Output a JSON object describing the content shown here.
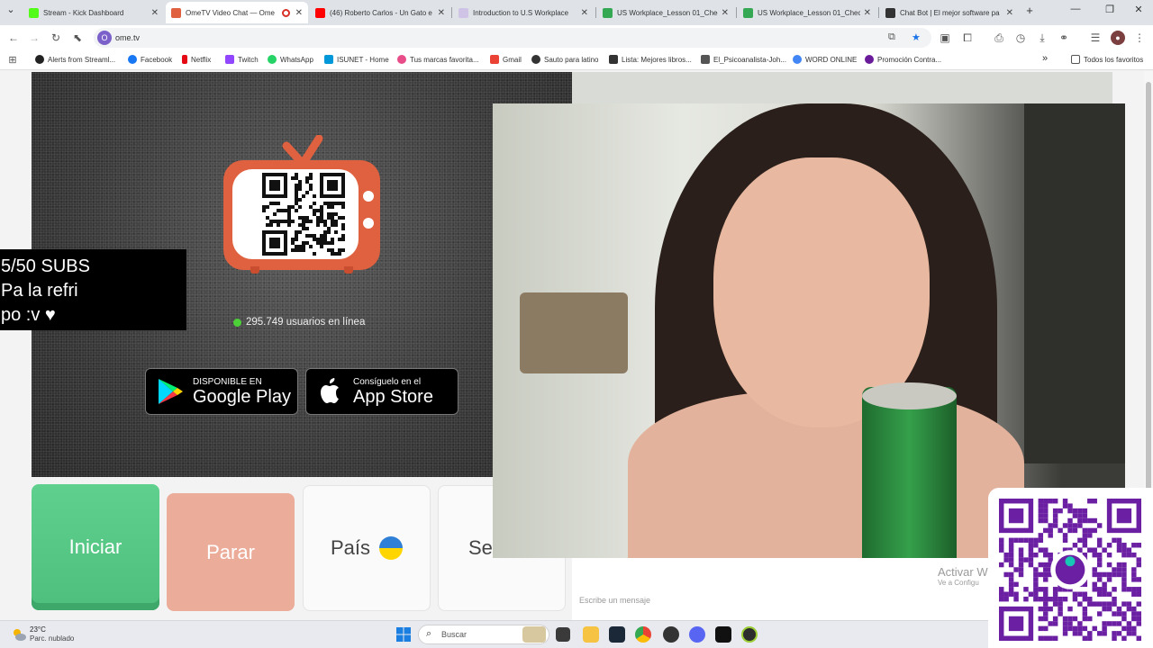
{
  "browser": {
    "tabs": [
      {
        "title": "Stream - Kick Dashboard",
        "favicon_color": "#53fc18",
        "active": false
      },
      {
        "title": "OmeTV Video Chat — Ome",
        "favicon_color": "#e0613f",
        "active": true
      },
      {
        "title": "(46) Roberto Carlos - Un Gato e",
        "favicon_color": "#ff0000",
        "active": false
      },
      {
        "title": "Introduction to U.S Workplace",
        "favicon_color": "#cfc4e6",
        "active": false
      },
      {
        "title": "US Workplace_Lesson 01_Chec",
        "favicon_color": "#34a853",
        "active": false
      },
      {
        "title": "US Workplace_Lesson 01_Chec",
        "favicon_color": "#34a853",
        "active": false
      },
      {
        "title": "Chat Bot | El mejor software pa",
        "favicon_color": "#333333",
        "active": false
      }
    ],
    "new_tab_label": "+",
    "url": "ome.tv",
    "site_icon_letter": "O",
    "bookmarks": [
      {
        "label": "Alerts from Streaml...",
        "icon_color": "#31c3a2"
      },
      {
        "label": "Facebook",
        "icon_color": "#1877f2"
      },
      {
        "label": "Netflix",
        "icon_color": "#e50914"
      },
      {
        "label": "Twitch",
        "icon_color": "#9146ff"
      },
      {
        "label": "WhatsApp",
        "icon_color": "#25d366"
      },
      {
        "label": "ISUNET - Home",
        "icon_color": "#0098d8"
      },
      {
        "label": "Tus marcas favorita...",
        "icon_color": "#e84d8a"
      },
      {
        "label": "Gmail",
        "icon_color": "#ea4335"
      },
      {
        "label": "Sauto para latino",
        "icon_color": "#333333"
      },
      {
        "label": "Lista: Mejores libros...",
        "icon_color": "#333333"
      },
      {
        "label": "El_Psicoanalista-Joh...",
        "icon_color": "#555555"
      },
      {
        "label": "WORD ONLINE",
        "icon_color": "#4285f4"
      },
      {
        "label": "Promoción Contra...",
        "icon_color": "#6a1b9a"
      }
    ],
    "all_bookmarks_label": "Todos los favoritos"
  },
  "partner_area": {
    "online_count_text": "295.749 usuarios en línea",
    "google_play": {
      "small": "DISPONIBLE EN",
      "big": "Google Play"
    },
    "app_store": {
      "small": "Consíguelo en el",
      "big": "App Store"
    }
  },
  "stream_overlay": {
    "line1": "5/50 SUBS",
    "line2": "Pa la refri",
    "line3": "po :v ♥"
  },
  "controls": {
    "start_label": "Iniciar",
    "stop_label": "Parar",
    "country_label": "País",
    "sex_label": "Sex"
  },
  "chat": {
    "input_placeholder": "Escribe un mensaje",
    "activate_line1": "Activar W",
    "activate_line2": "Ve a Configu"
  },
  "taskbar": {
    "temperature": "23°C",
    "weather": "Parc. nublado",
    "search_label": "Buscar"
  },
  "colors": {
    "start_green": "#55c885",
    "stop_salmon": "#ecac9a",
    "tv_orange": "#e0613f",
    "yape_purple": "#6b1fa2"
  }
}
